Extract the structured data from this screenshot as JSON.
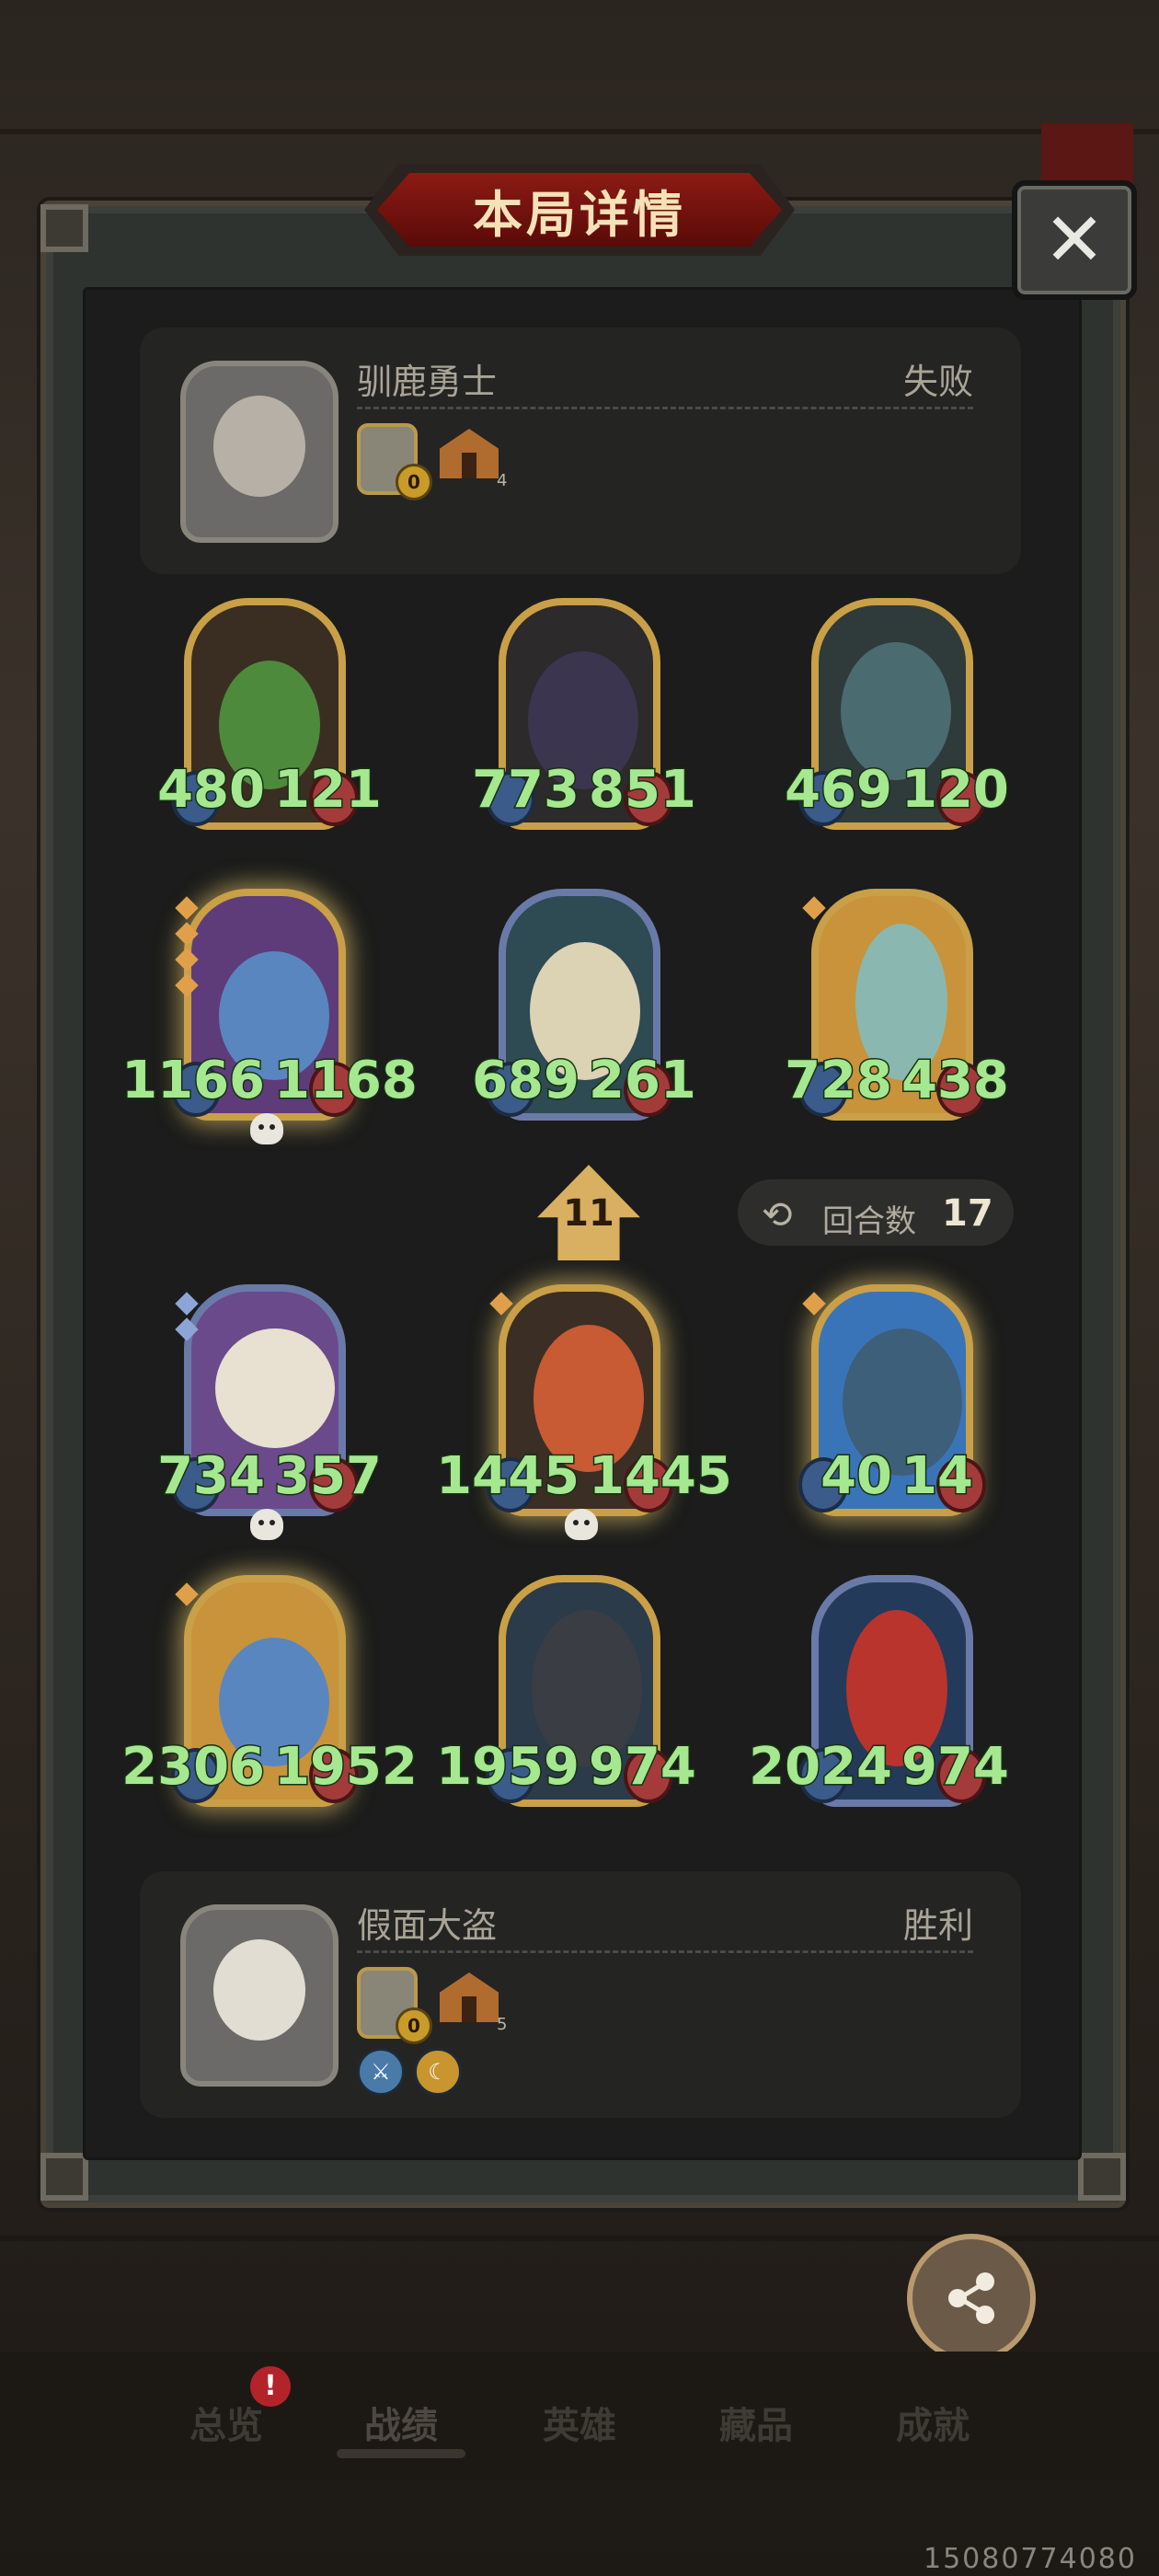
{
  "header": {
    "title": "本局详情",
    "close_label": "✕"
  },
  "opponent": {
    "name": "驯鹿勇士",
    "result": "失败",
    "coins": "0",
    "tavern_level": "4"
  },
  "opponent_board": [
    {
      "attack": "480",
      "health": "121"
    },
    {
      "attack": "773",
      "health": "851"
    },
    {
      "attack": "469",
      "health": "120"
    },
    {
      "attack": "1166",
      "health": "1168"
    },
    {
      "attack": "689",
      "health": "261"
    },
    {
      "attack": "728",
      "health": "438"
    }
  ],
  "round_info": {
    "round_number": "11",
    "turns_label": "回合数",
    "turns_value": "17"
  },
  "player_board": [
    {
      "attack": "734",
      "health": "357"
    },
    {
      "attack": "1445",
      "health": "1445"
    },
    {
      "attack": "40",
      "health": "14"
    },
    {
      "attack": "2306",
      "health": "1952"
    },
    {
      "attack": "1959",
      "health": "974"
    },
    {
      "attack": "2024",
      "health": "974"
    }
  ],
  "player": {
    "name": "假面大盗",
    "result": "胜利",
    "coins": "0",
    "tavern_level": "5"
  },
  "share": {
    "label": "分享"
  },
  "bottom_nav": {
    "items": [
      "总览",
      "战绩",
      "英雄",
      "藏品",
      "成就"
    ],
    "active": "战绩",
    "badge": "!"
  },
  "watermark": "15080774080",
  "colors": {
    "stat_text": "#a5e890",
    "gold_frame": "#c9a047",
    "title_red": "#8c1a14"
  },
  "icons": [
    "close-icon",
    "share-icon",
    "coin-icon",
    "tavern-icon",
    "skull-icon",
    "turns-icon",
    "arrow-up-icon"
  ]
}
